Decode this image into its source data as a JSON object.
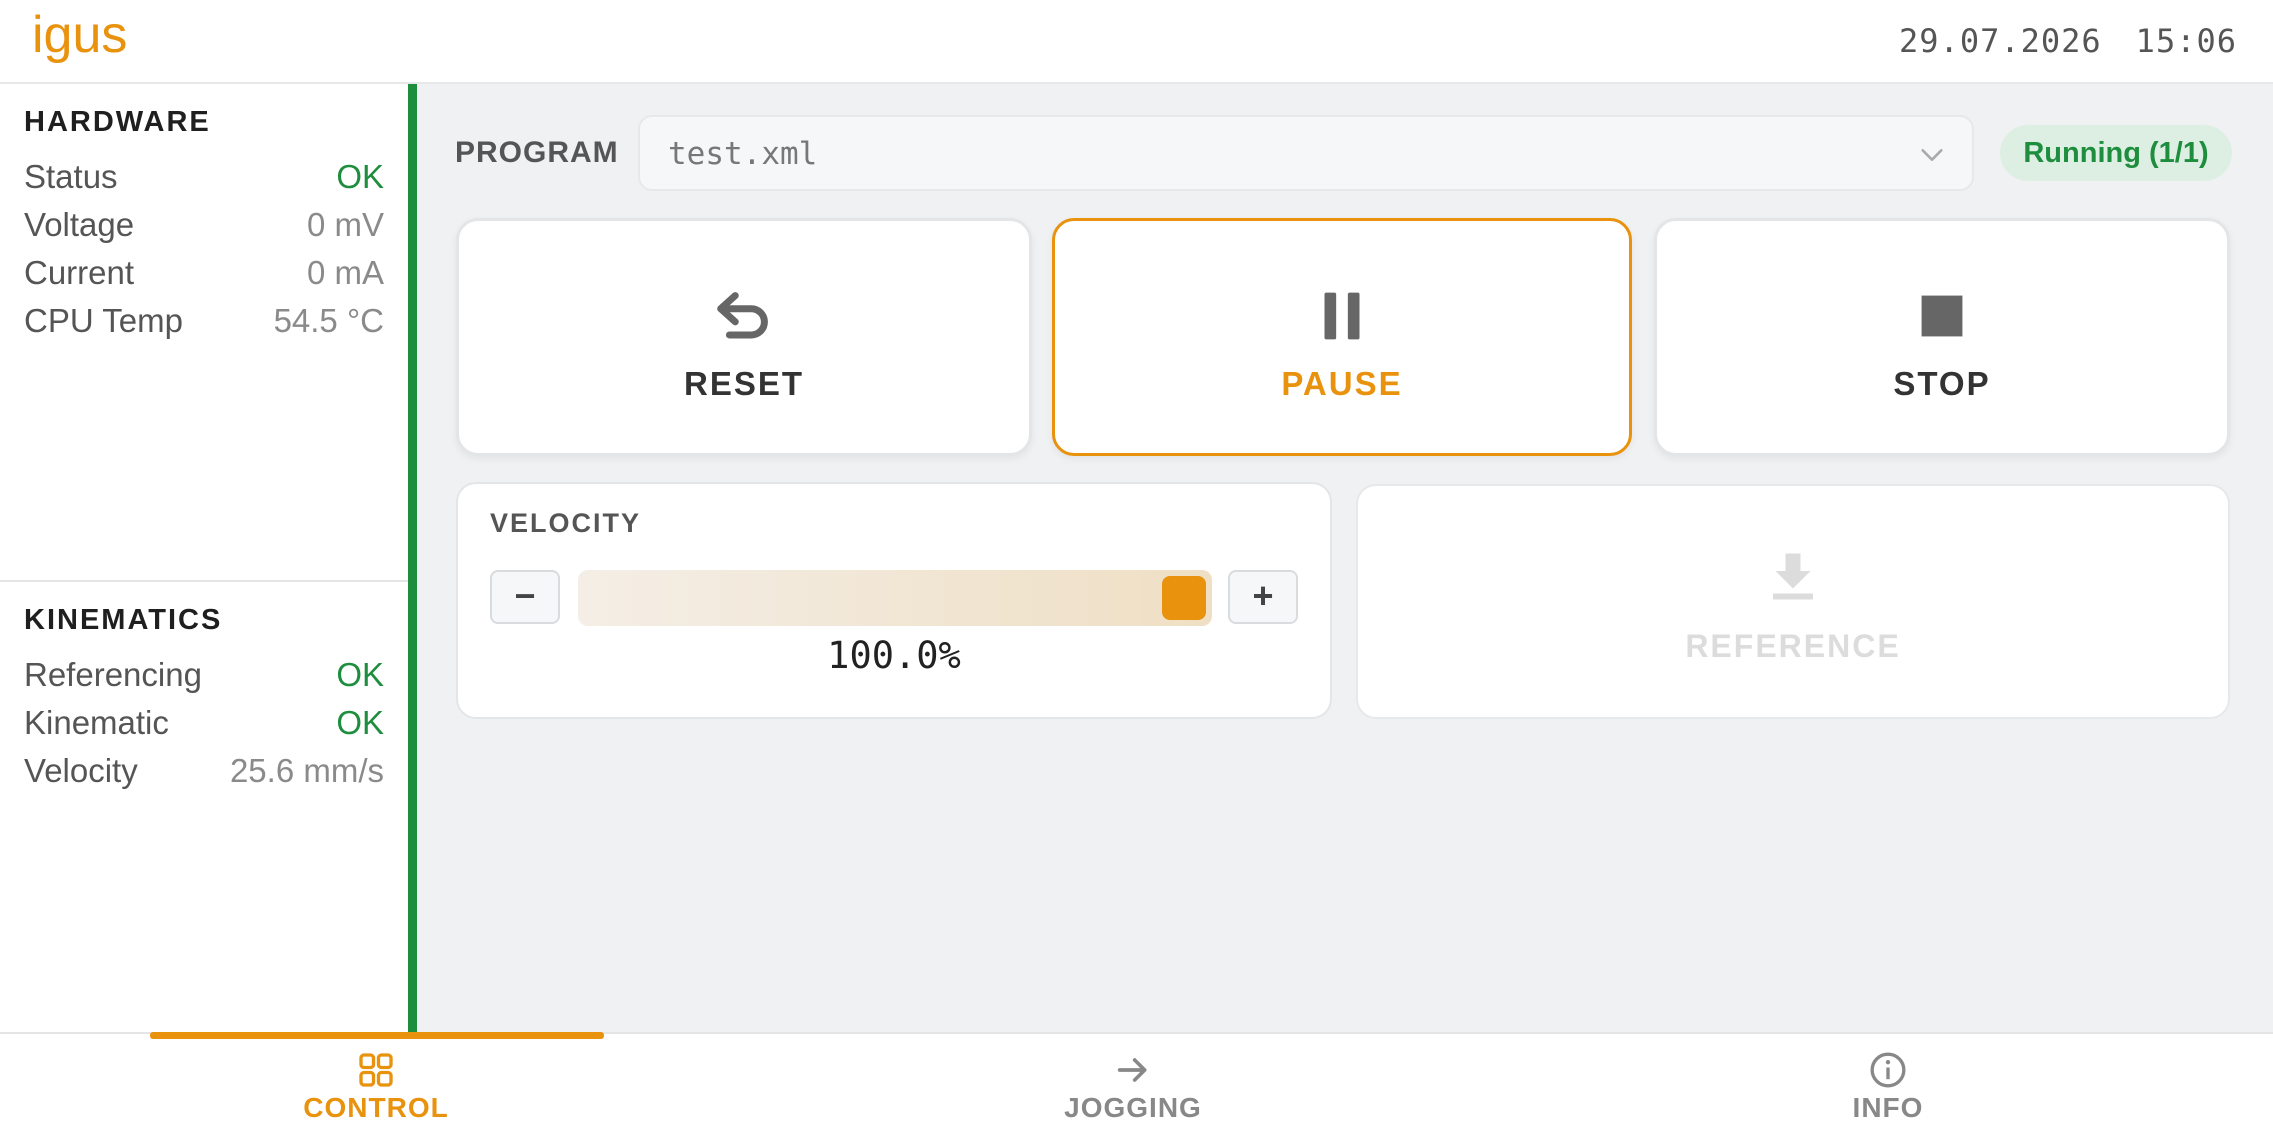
{
  "header": {
    "brand": "igus",
    "date": "29.07.2026",
    "time": "15:06"
  },
  "hardware": {
    "title": "HARDWARE",
    "rows": [
      {
        "label": "Status",
        "value": "OK"
      },
      {
        "label": "Voltage",
        "value": "0 mV"
      },
      {
        "label": "Current",
        "value": "0 mA"
      },
      {
        "label": "CPU Temp",
        "value": "54.5 °C"
      }
    ]
  },
  "kinematics": {
    "title": "KINEMATICS",
    "rows": [
      {
        "label": "Referencing",
        "value": "OK"
      },
      {
        "label": "Kinematic",
        "value": "OK"
      },
      {
        "label": "Velocity",
        "value": "25.6 mm/s"
      }
    ]
  },
  "program": {
    "label": "PROGRAM",
    "selected": "test.xml",
    "status": "Running (1/1)"
  },
  "controls": {
    "reset": "RESET",
    "pause": "PAUSE",
    "stop": "STOP",
    "reference": "REFERENCE"
  },
  "velocity": {
    "title": "VELOCITY",
    "minus": "−",
    "plus": "+",
    "display": "100.0%",
    "fraction": 1.0
  },
  "nav": {
    "control": "CONTROL",
    "jogging": "JOGGING",
    "info": "INFO"
  },
  "colors": {
    "accent": "#e8920d",
    "ok": "#1e8e3e",
    "background": "#eff1f3"
  }
}
